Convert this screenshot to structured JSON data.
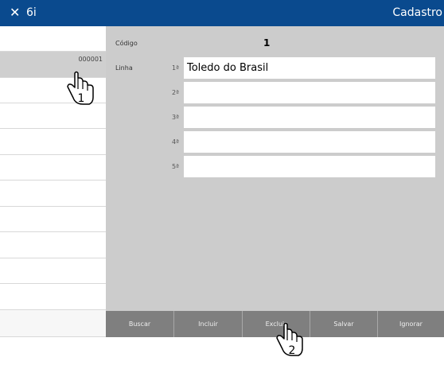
{
  "titlebar": {
    "close_icon": "close-icon",
    "app_name": "6i",
    "module": "Cadastro"
  },
  "sidebar": {
    "items": [
      {
        "code": "000001",
        "selected": true
      },
      {
        "code": ""
      },
      {
        "code": ""
      },
      {
        "code": ""
      },
      {
        "code": ""
      },
      {
        "code": ""
      },
      {
        "code": ""
      },
      {
        "code": ""
      },
      {
        "code": ""
      },
      {
        "code": ""
      },
      {
        "code": ""
      }
    ]
  },
  "form": {
    "codigo_label": "Código",
    "codigo_value": "1",
    "linha_label": "Linha",
    "lines": [
      {
        "ordinal": "1ª",
        "value": "Toledo do Brasil"
      },
      {
        "ordinal": "2ª",
        "value": ""
      },
      {
        "ordinal": "3ª",
        "value": ""
      },
      {
        "ordinal": "4ª",
        "value": ""
      },
      {
        "ordinal": "5ª",
        "value": ""
      }
    ]
  },
  "toolbar": {
    "buscar": "Buscar",
    "incluir": "Incluir",
    "excluir": "Excluir",
    "salvar": "Salvar",
    "ignorar": "Ignorar"
  },
  "callouts": {
    "step1": "1",
    "step2": "2"
  },
  "colors": {
    "titlebar": "#0a4a8e",
    "panel": "#cccccc",
    "button_bar": "#7f7f7f",
    "selected_row": "#cfcfcf"
  }
}
